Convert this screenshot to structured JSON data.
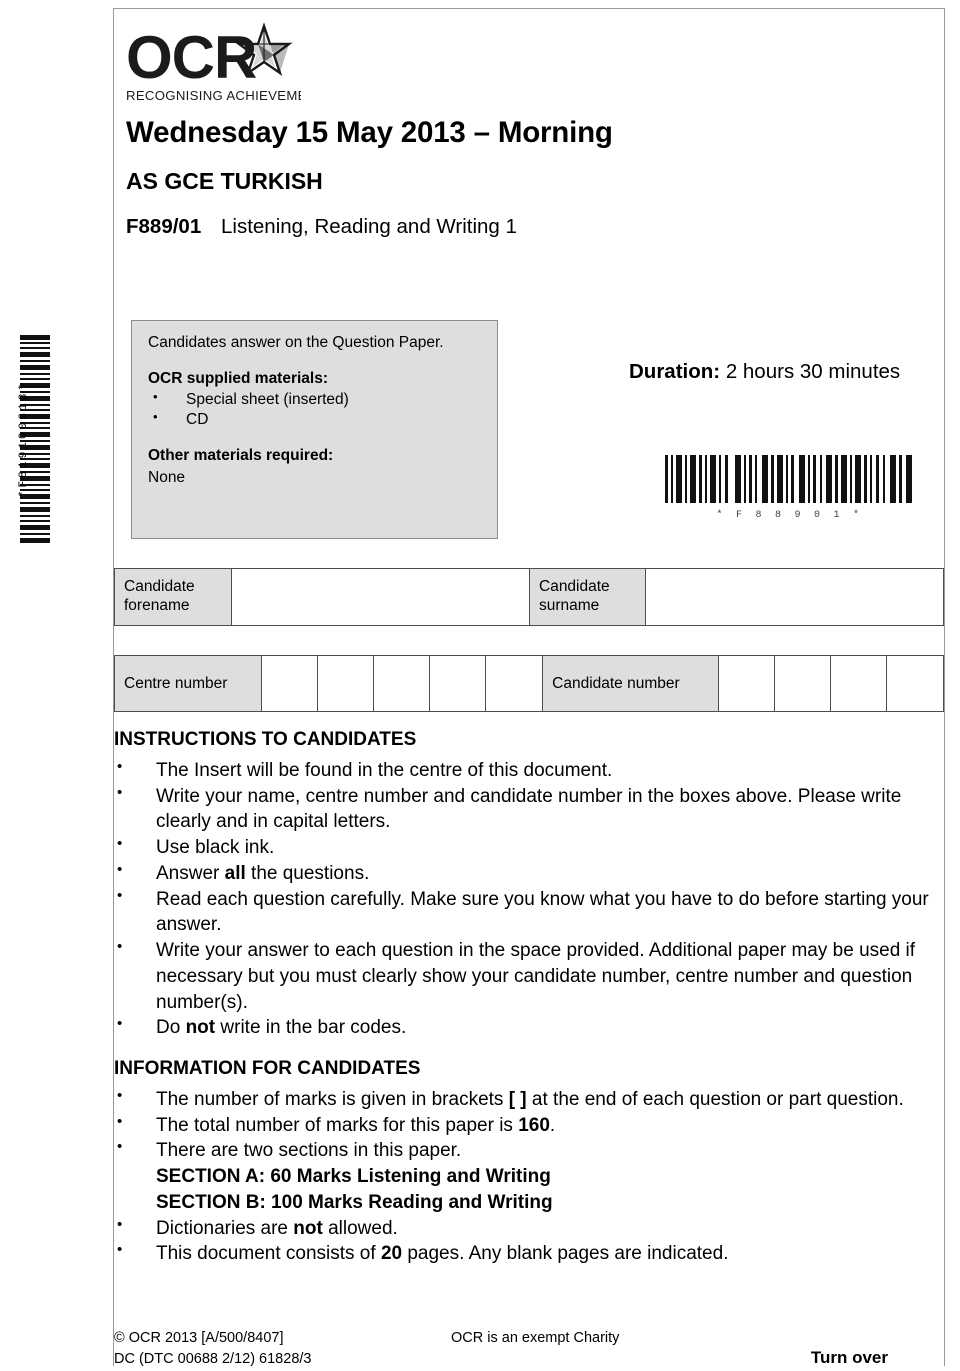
{
  "logo": {
    "wordmark": "OCR",
    "tagline": "RECOGNISING ACHIEVEMENT",
    "star_icon": "star-icon"
  },
  "header": {
    "exam_date": "Wednesday 15 May 2013 – Morning",
    "qualification": "AS GCE TURKISH",
    "unit_code": "F889/01",
    "unit_title": "Listening, Reading and Writing 1"
  },
  "materials_box": {
    "lead": "Candidates answer on the Question Paper.",
    "supplied_heading": "OCR supplied materials:",
    "supplied_items": [
      "Special sheet (inserted)",
      "CD"
    ],
    "other_heading": "Other materials required:",
    "other_value": "None"
  },
  "duration": {
    "label": "Duration:",
    "value": "2 hours 30 minutes"
  },
  "barcodes": {
    "horizontal_text": "*F88901*",
    "vertical_text": "*F819100613*"
  },
  "candidate_fields": {
    "forename_label": "Candidate forename",
    "forename_line1": "Candidate",
    "forename_line2": "forename",
    "surname_line1": "Candidate",
    "surname_line2": "surname",
    "centre_number_label": "Centre number",
    "centre_number_cells": 5,
    "candidate_number_label": "Candidate number",
    "candidate_number_cells": 4
  },
  "instructions": {
    "heading": "INSTRUCTIONS TO CANDIDATES",
    "items": [
      "The Insert will be found in the centre of this document.",
      "Write your name, centre number and candidate number in the boxes above. Please write clearly and in capital letters.",
      "Use black ink.",
      "Answer all the questions.",
      "Read each question carefully. Make sure you know what you have to do before starting your answer.",
      "Write your answer to each question in the space provided. Additional paper may be used if necessary but you must clearly show your candidate number, centre number and question number(s).",
      "Do not write in the bar codes."
    ]
  },
  "information": {
    "heading": "INFORMATION FOR CANDIDATES",
    "items": [
      "The number of marks is given in brackets [ ] at the end of each question or part question.",
      "The total number of marks for this paper is 160.",
      "There are two sections in this paper.",
      "Dictionaries are not allowed.",
      "This document consists of 20 pages. Any blank pages are indicated."
    ],
    "section_a": "SECTION A: 60 Marks   Listening and Writing",
    "section_b": "SECTION B: 100 Marks  Reading and Writing",
    "total_marks": "160",
    "page_count": "20"
  },
  "footer": {
    "copyright": "© OCR 2013  [A/500/8407]",
    "doc_code": "DC (DTC 00688 2/12) 61828/3",
    "charity": "OCR is an exempt Charity",
    "turn_over": "Turn over"
  }
}
